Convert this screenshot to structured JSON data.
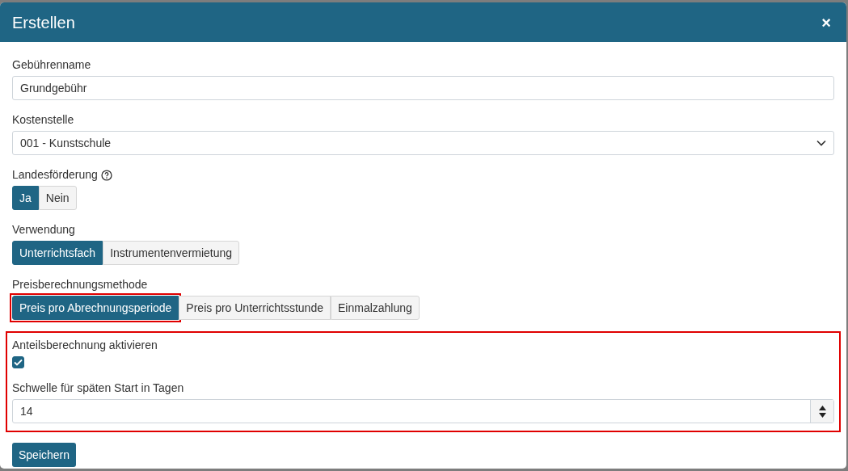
{
  "dialog": {
    "title": "Erstellen",
    "close": "×"
  },
  "fields": [
    {
      "kind": "text",
      "label": "Gebührenname",
      "value": "Grundgebühr"
    },
    {
      "kind": "select",
      "label": "Kostenstelle",
      "value": "001 - Kunstschule"
    },
    {
      "kind": "toggle",
      "label": "Landesförderung",
      "help": true,
      "highlighted": false,
      "options": [
        {
          "label": "Ja",
          "selected": true
        },
        {
          "label": "Nein",
          "selected": false
        }
      ]
    },
    {
      "kind": "toggle",
      "label": "Verwendung",
      "help": false,
      "highlighted": false,
      "options": [
        {
          "label": "Unterrichtsfach",
          "selected": true
        },
        {
          "label": "Instrumentenvermietung",
          "selected": false
        }
      ]
    },
    {
      "kind": "toggle",
      "label": "Preisberechnungsmethode",
      "help": false,
      "highlighted": true,
      "options": [
        {
          "label": "Preis pro Abrechnungsperiode",
          "selected": true
        },
        {
          "label": "Preis pro Unterrichtsstunde",
          "selected": false
        },
        {
          "label": "Einmalzahlung",
          "selected": false
        }
      ]
    }
  ],
  "proration": {
    "highlighted": true,
    "label": "Anteilsberechnung aktivieren",
    "checked": true,
    "threshold_label": "Schwelle für späten Start in Tagen",
    "threshold_value": "14"
  },
  "save_button": "Speichern"
}
